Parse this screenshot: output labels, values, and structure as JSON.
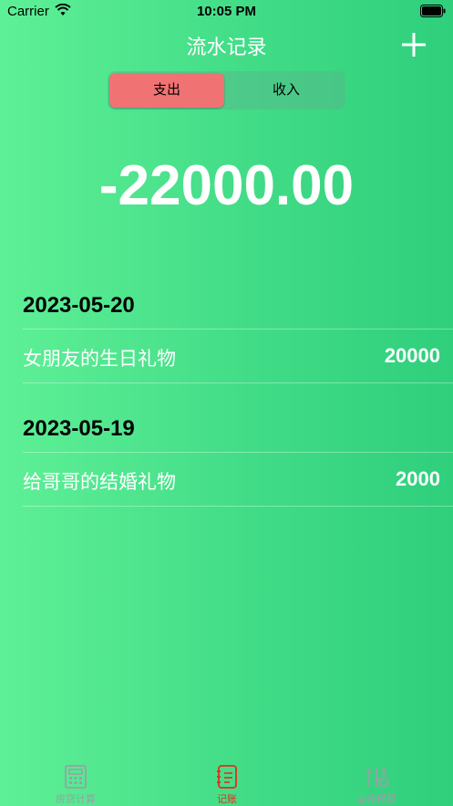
{
  "status": {
    "carrier": "Carrier",
    "time": "10:05 PM"
  },
  "header": {
    "title": "流水记录"
  },
  "segment": {
    "options": [
      "支出",
      "收入"
    ],
    "selected": "支出"
  },
  "total": "-22000.00",
  "groups": [
    {
      "date": "2023-05-20",
      "records": [
        {
          "desc": "女朋友的生日礼物",
          "amount": "20000"
        }
      ]
    },
    {
      "date": "2023-05-19",
      "records": [
        {
          "desc": "给哥哥的结婚礼物",
          "amount": "2000"
        }
      ]
    }
  ],
  "tabs": [
    {
      "label": "房贷计算",
      "icon": "calculator-icon"
    },
    {
      "label": "记账",
      "icon": "ledger-icon",
      "active": true
    },
    {
      "label": "装修预算",
      "icon": "tools-icon"
    }
  ],
  "colors": {
    "accent": "#f07272",
    "active_tab": "#e0301e",
    "bg_start": "#5ef096",
    "bg_end": "#2fcf7c"
  }
}
